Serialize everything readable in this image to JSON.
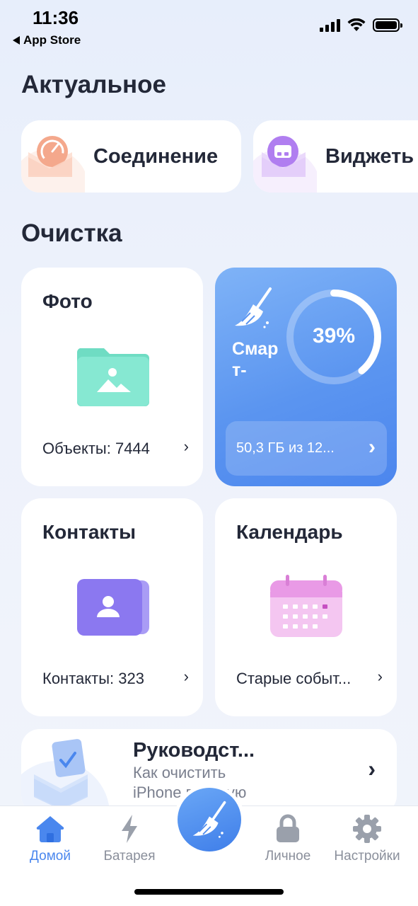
{
  "status_bar": {
    "time": "11:36",
    "back_label": "App Store"
  },
  "sections": {
    "actual_title": "Актуальное",
    "cleanup_title": "Очистка"
  },
  "actual": [
    {
      "label": "Соединение",
      "icon": "speedometer-icon",
      "accent": "#f3a98c"
    },
    {
      "label": "Виджеть",
      "icon": "widget-icon",
      "accent": "#b07ef0"
    }
  ],
  "cards": {
    "photo": {
      "title": "Фото",
      "foot": "Объекты: 7444",
      "chevron": "›",
      "accent": "#7fe6cf"
    },
    "contacts": {
      "title": "Контакты",
      "foot": "Контакты: 323",
      "chevron": "›",
      "accent": "#8b78f0"
    },
    "calendar": {
      "title": "Календарь",
      "foot": "Старые событ...",
      "chevron": "›",
      "accent": "#e99ae6"
    }
  },
  "smart": {
    "label": "Смар т-",
    "percent_text": "39%",
    "percent_value": 0.39,
    "storage": "50,3 ГБ из 12...",
    "chevron": "›"
  },
  "guide": {
    "title": "Руководст...",
    "subtitle": "Как очистить iPhone вручную",
    "chevron": "›"
  },
  "tabs": [
    {
      "label": "Домой",
      "icon": "home-icon",
      "active": true
    },
    {
      "label": "Батарея",
      "icon": "bolt-icon",
      "active": false
    },
    {
      "label": "Личное",
      "icon": "lock-icon",
      "active": false
    },
    {
      "label": "Настройки",
      "icon": "gear-icon",
      "active": false
    }
  ],
  "colors": {
    "accent_blue": "#4a87ee",
    "text_dark": "#232838",
    "tab_inactive": "#8a8f9b"
  }
}
